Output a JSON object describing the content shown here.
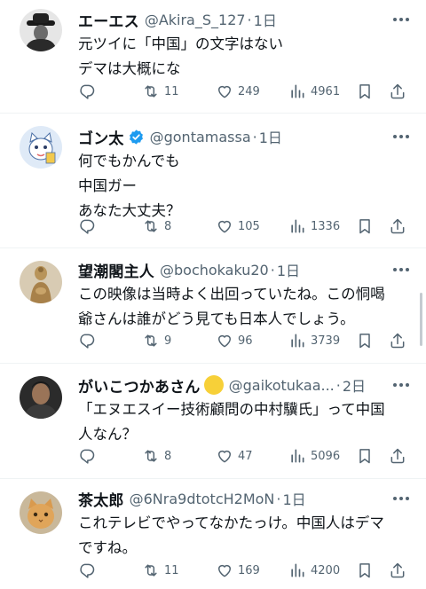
{
  "tweets": [
    {
      "name": "エーエス",
      "handle": "@Akira_S_127",
      "separator": "·",
      "time": "1日",
      "lines": [
        "元ツイに「中国」の文字はない",
        "デマは大概にな"
      ],
      "replies": "",
      "retweets": "11",
      "likes": "249",
      "views": "4961",
      "avatar": "man-in-hat-bw"
    },
    {
      "name": "ゴン太",
      "verified": true,
      "handle": "@gontamassa",
      "separator": "·",
      "time": "1日",
      "lines": [
        "何でもかんでも",
        "中国ガー",
        "あなた大丈夫？"
      ],
      "replies": "",
      "retweets": "8",
      "likes": "105",
      "views": "1336",
      "avatar": "cat-illustration"
    },
    {
      "name": "望潮閣主人",
      "handle": "@bochokaku20",
      "separator": "·",
      "time": "1日",
      "lines": [
        "この映像は当時よく出回っていたね。この恫喝",
        "爺さんは誰がどう見ても日本人でしょう。"
      ],
      "replies": "",
      "retweets": "9",
      "likes": "96",
      "views": "3739",
      "avatar": "buddha-statue"
    },
    {
      "name": "がいこつかあさん",
      "emoji": "yellow-circle",
      "handle": "@gaikotukaa...",
      "separator": "·",
      "time": "2日",
      "lines": [
        "「エヌエスイー技術顧問の中村驥氏」って中国",
        "人なん？"
      ],
      "replies": "",
      "retweets": "8",
      "likes": "47",
      "views": "5096",
      "avatar": "man-portrait-dark"
    },
    {
      "name": "茶太郎",
      "handle": "@6Nra9dtotcH2MoN",
      "separator": "·",
      "time": "1日",
      "lines": [
        "これテレビでやってなかたっけ。中国人はデマ",
        "ですね。"
      ],
      "replies": "",
      "retweets": "11",
      "likes": "169",
      "views": "4200",
      "avatar": "orange-cat-photo"
    }
  ],
  "icons": {
    "reply": "reply-icon",
    "retweet": "retweet-icon",
    "like": "heart-icon",
    "views": "views-icon",
    "bookmark": "bookmark-icon",
    "share": "share-icon",
    "more": "more-icon",
    "verified": "verified-badge-icon"
  },
  "colors": {
    "text": "#0f1419",
    "secondary": "#536471",
    "verified": "#1d9bf0",
    "divider": "#eff3f4"
  }
}
